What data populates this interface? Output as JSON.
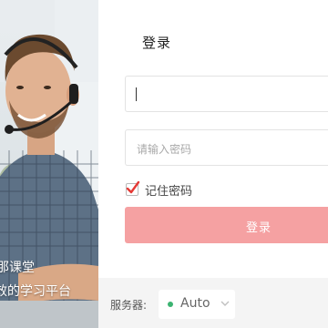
{
  "hero": {
    "line1": "那课堂",
    "line2": "效的学习平台"
  },
  "login": {
    "title": "登录",
    "username_value": "",
    "password_placeholder": "请输入密码",
    "remember_label": "记住密码",
    "remember_checked": true,
    "submit_label": "登录"
  },
  "server": {
    "label": "服务器:",
    "selected": "Auto",
    "status_color": "#3cb371"
  },
  "colors": {
    "accent": "#f5a1a2",
    "check": "#e53935"
  },
  "icons": {
    "checkbox": "check-icon",
    "status": "status-dot-icon",
    "dropdown": "chevron-down-icon"
  }
}
